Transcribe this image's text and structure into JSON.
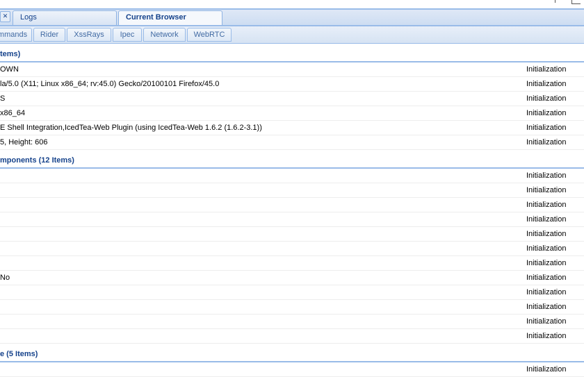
{
  "main_tabs": [
    {
      "label": "Logs"
    },
    {
      "label": "Current Browser"
    }
  ],
  "close_glyph": "✕",
  "sub_tabs": [
    {
      "label": "mmands"
    },
    {
      "label": "Rider"
    },
    {
      "label": "XssRays"
    },
    {
      "label": "Ipec"
    },
    {
      "label": "Network"
    },
    {
      "label": "WebRTC"
    }
  ],
  "groups": [
    {
      "header": "tems)",
      "rows": [
        {
          "value": "OWN",
          "source": "Initialization"
        },
        {
          "value": "la/5.0 (X11; Linux x86_64; rv:45.0) Gecko/20100101 Firefox/45.0",
          "source": "Initialization"
        },
        {
          "value": "S",
          "source": "Initialization"
        },
        {
          "value": "x86_64",
          "source": "Initialization"
        },
        {
          "value": "E Shell Integration,IcedTea-Web Plugin (using IcedTea-Web 1.6.2 (1.6.2-3.1))",
          "source": "Initialization"
        },
        {
          "value": "5, Height: 606",
          "source": "Initialization"
        }
      ]
    },
    {
      "header": "mponents (12 Items)",
      "rows": [
        {
          "value": "",
          "source": "Initialization"
        },
        {
          "value": "",
          "source": "Initialization"
        },
        {
          "value": "",
          "source": "Initialization"
        },
        {
          "value": "",
          "source": "Initialization"
        },
        {
          "value": "",
          "source": "Initialization"
        },
        {
          "value": "",
          "source": "Initialization"
        },
        {
          "value": "",
          "source": "Initialization"
        },
        {
          "value": "No",
          "source": "Initialization"
        },
        {
          "value": "",
          "source": "Initialization"
        },
        {
          "value": "",
          "source": "Initialization"
        },
        {
          "value": "",
          "source": "Initialization"
        },
        {
          "value": "",
          "source": "Initialization"
        }
      ]
    },
    {
      "header": "e (5 Items)",
      "rows": [
        {
          "value": "",
          "source": "Initialization"
        }
      ]
    }
  ]
}
